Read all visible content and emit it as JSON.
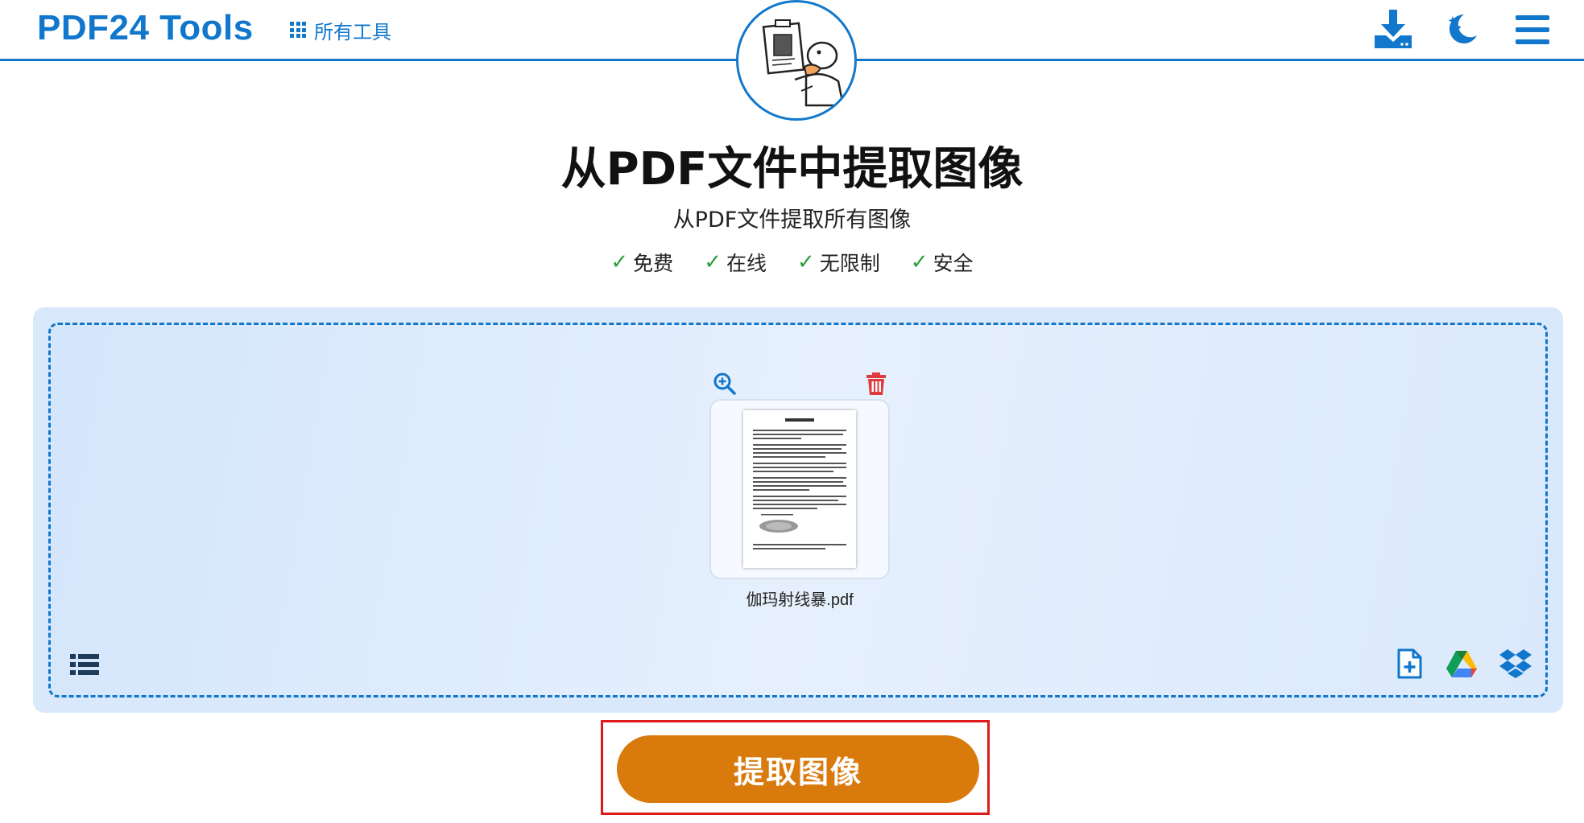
{
  "header": {
    "logo": "PDF24 Tools",
    "all_tools_label": "所有工具"
  },
  "hero": {
    "title": "从PDF文件中提取图像",
    "subtitle": "从PDF文件提取所有图像",
    "features": [
      "免费",
      "在线",
      "无限制",
      "安全"
    ],
    "check_mark": "✓"
  },
  "file": {
    "name": "伽玛射线暴.pdf"
  },
  "action": {
    "button_label": "提取图像"
  },
  "colors": {
    "brand": "#1177cc",
    "action": "#d97a0c",
    "check": "#2d9e3a",
    "delete": "#e03b3b",
    "highlight_box": "#e01a1a"
  },
  "icons": [
    "grid-icon",
    "download-icon",
    "theme-toggle-icon",
    "menu-icon",
    "zoom-in-icon",
    "trash-icon",
    "list-view-icon",
    "add-file-icon",
    "google-drive-icon",
    "dropbox-icon"
  ]
}
